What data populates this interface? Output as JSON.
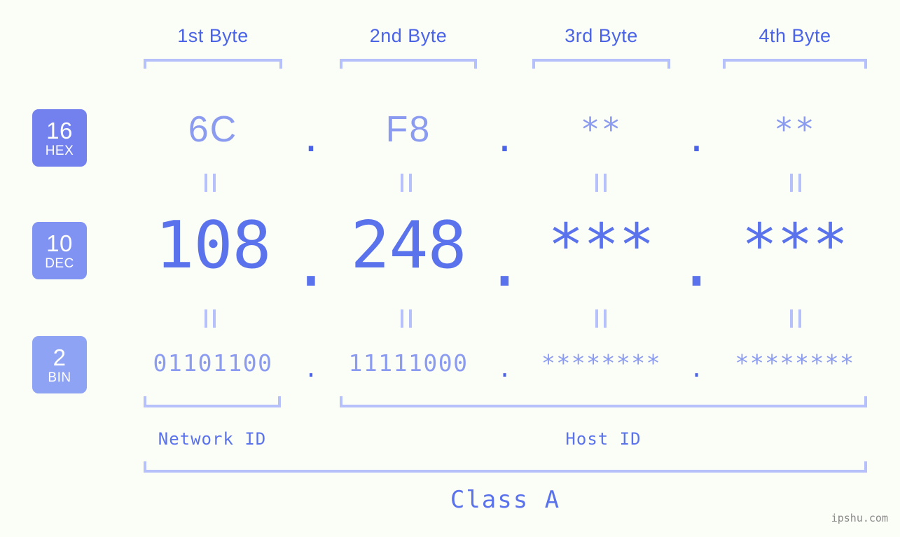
{
  "bytes": {
    "headers": [
      "1st Byte",
      "2nd Byte",
      "3rd Byte",
      "4th Byte"
    ]
  },
  "bases": [
    {
      "num": "16",
      "abbr": "HEX",
      "color": "#7381ef"
    },
    {
      "num": "10",
      "abbr": "DEC",
      "color": "#8193f2"
    },
    {
      "num": "2",
      "abbr": "BIN",
      "color": "#8fa3f5"
    }
  ],
  "rows": {
    "hex": {
      "values": [
        "6C",
        "F8",
        "**",
        "**"
      ],
      "separator": "."
    },
    "dec": {
      "values": [
        "108",
        "248",
        "***",
        "***"
      ],
      "separator": "."
    },
    "bin": {
      "values": [
        "01101100",
        "11111000",
        "********",
        "********"
      ],
      "separator": "."
    }
  },
  "equals_mark": "=",
  "sections": {
    "network_id": "Network ID",
    "host_id": "Host ID",
    "class": "Class A"
  },
  "watermark": "ipshu.com",
  "colors": {
    "background": "#fbfdf7",
    "accent_dark": "#4a63e7",
    "accent_mid": "#5a72ec",
    "accent_light": "#8b9bf0",
    "bracket": "#b6c1fb",
    "watermark": "#8a8a8a"
  }
}
